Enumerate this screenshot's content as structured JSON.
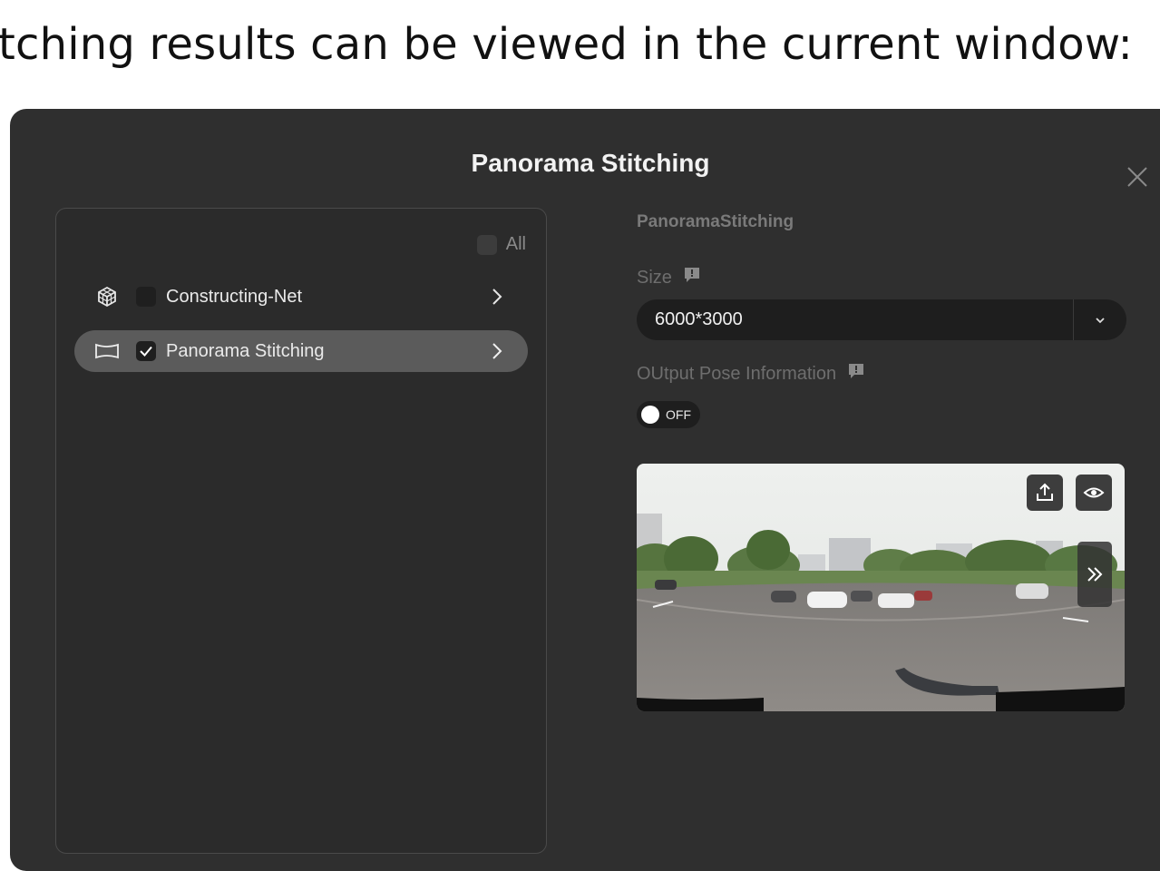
{
  "caption": "tching results can be viewed in the current window:",
  "dialog": {
    "title": "Panorama Stitching"
  },
  "task_list": {
    "all_label": "All",
    "items": [
      {
        "label": "Constructing-Net",
        "checked": false,
        "icon": "cube-icon"
      },
      {
        "label": "Panorama Stitching",
        "checked": true,
        "selected": true,
        "icon": "panorama-icon"
      }
    ]
  },
  "settings": {
    "section_title": "PanoramaStitching",
    "size_label": "Size",
    "size_value": "6000*3000",
    "pose_label": "OUtput Pose Information",
    "pose_toggle_text": "OFF"
  },
  "colors": {
    "dialog_bg": "#2f2f2f",
    "selected_row": "#5b5b5b"
  }
}
